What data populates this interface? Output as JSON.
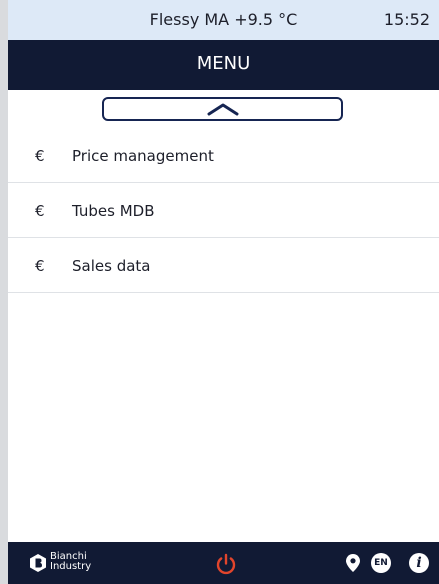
{
  "status": {
    "title": "Flessy MA +9.5 °C",
    "time": "15:52"
  },
  "header": {
    "title": "MENU"
  },
  "scroll": {
    "up_icon": "chevron-up-icon"
  },
  "menu": {
    "items": [
      {
        "icon": "€",
        "label": "Price management"
      },
      {
        "icon": "€",
        "label": "Tubes MDB"
      },
      {
        "icon": "€",
        "label": "Sales data"
      }
    ]
  },
  "footer": {
    "brand_line1": "Bianchi",
    "brand_line2": "Industry",
    "language": "EN",
    "info": "i",
    "power_color": "#e2452c"
  },
  "colors": {
    "status_bg": "#dde9f7",
    "header_bg": "#111a34",
    "accent_border": "#162552"
  }
}
